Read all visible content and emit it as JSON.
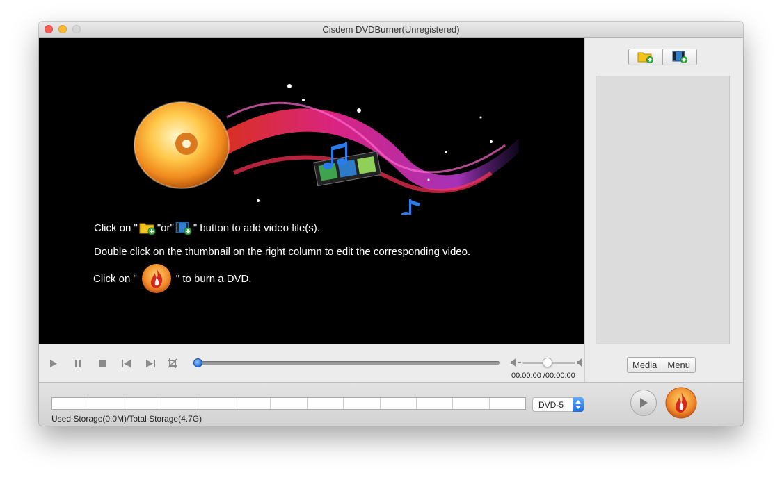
{
  "window": {
    "title": "Cisdem DVDBurner(Unregistered)"
  },
  "preview": {
    "line1_prefix": "Click on \"",
    "line1_middle": "\"or\"",
    "line1_suffix": "\" button to add video file(s).",
    "line2": "Double click on the thumbnail on the right column to edit the corresponding video.",
    "line3_prefix": "Click on  \"",
    "line3_suffix": "\"  to burn a DVD."
  },
  "sidebar": {
    "add_buttons": [
      {
        "icon": "add-folder-icon"
      },
      {
        "icon": "add-video-icon"
      }
    ],
    "tabs": [
      {
        "label": "Media"
      },
      {
        "label": "Menu"
      }
    ]
  },
  "player": {
    "progress_fraction": 0.0,
    "volume_fraction": 0.48,
    "time": "00:00:00 /00:00:00",
    "icons": [
      "play-icon",
      "pause-icon",
      "stop-icon",
      "previous-icon",
      "next-icon",
      "crop-icon",
      "volume-down-icon",
      "volume-up-icon"
    ]
  },
  "bottom": {
    "storage_text": "Used Storage(0.0M)/Total Storage(4.7G)",
    "storage_used_fraction": 0.0,
    "disc_type": "DVD-5"
  },
  "colors": {
    "accent_blue": "#2a6fd6",
    "burn_orange": "#f08a2a",
    "preview_bg": "#000000"
  }
}
